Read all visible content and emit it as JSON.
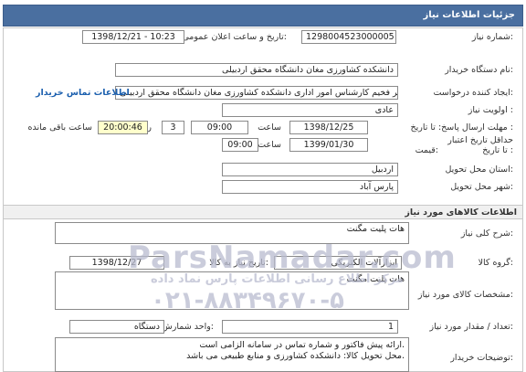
{
  "header": {
    "title": "جزئیات اطلاعات نیاز"
  },
  "details": {
    "need_number_label": "شماره نیاز:",
    "need_number": "1298004523000005",
    "announce_label": "تاریخ و ساعت اعلان عمومی:",
    "announce_value": "1398/12/21 - 10:23",
    "buyer_label": "نام دستگاه خریدار:",
    "buyer_value": "دانشکده کشاورزی مغان دانشگاه محقق اردبیلی",
    "creator_label": "ایجاد کننده درخواست:",
    "creator_value": "عسگر فخیم کارشناس امور اداری دانشکده کشاورزی مغان دانشگاه محقق اردبیلی",
    "contact_link": "اطلاعات تماس خریدار",
    "priority_label": "اولویت نیاز :",
    "priority_value": "عادی",
    "deadline_label": "مهلت ارسال پاسخ: تا تاریخ :",
    "deadline_date": "1398/12/25",
    "deadline_time_label": "ساعت",
    "deadline_time": "09:00",
    "days_value": "3",
    "days_label": "روز و",
    "remaining_time": "20:00:46",
    "remaining_label": "ساعت باقی مانده",
    "validity_label1": "حداقل تاریخ اعتبار",
    "validity_label2": "قیمت:",
    "validity_to_label": "تا تاریخ :",
    "validity_date": "1399/01/30",
    "validity_time_label": "ساعت",
    "validity_time": "09:00",
    "province_label": "استان محل تحویل:",
    "province_value": "اردبیل",
    "city_label": "شهر محل تحویل:",
    "city_value": "پارس آباد"
  },
  "goods": {
    "section_title": "اطلاعات کالاهای مورد نیاز",
    "summary_label": "شرح کلی نیاز:",
    "summary_value": "هات پلیت مگنت",
    "group_label": "گروه کالا:",
    "group_value": "ابزارآلات الکتریکی",
    "need_date_label": "تاریخ نیاز به کالا:",
    "need_date_value": "1398/12/27",
    "specs_label": "مشخصات کالای مورد نیاز:",
    "specs_value": "هات پلیت مگنت",
    "qty_label": "تعداد / مقدار مورد نیاز:",
    "qty_value": "1",
    "unit_label": "واحد شمارش:",
    "unit_value": "دستگاه",
    "desc_label": "توضیحات خریدار:",
    "desc_line1": "ارائه پیش فاکتور  و شماره تماس در سامانه الزامی است.",
    "desc_line2": "محل تحویل کالا: دانشکده کشاورزی و منابع طبیعی می باشد."
  },
  "watermark": {
    "brand": "ParsNamadar.com",
    "persian": "مرکز اطلاع رسانی اطلاعات پارس نماد داده",
    "phone": "۰۲۱-۸۸۳۴۹۶۷۰-۵"
  }
}
